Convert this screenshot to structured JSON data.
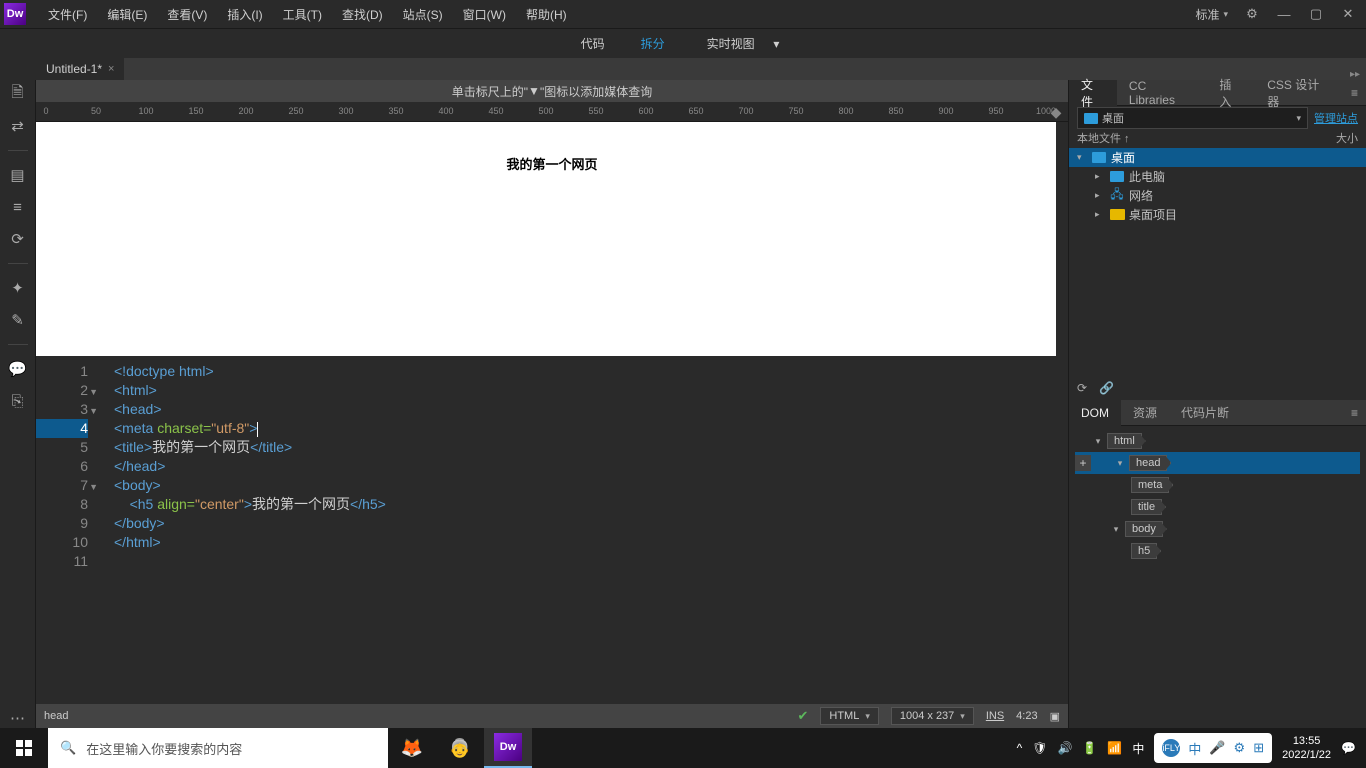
{
  "app": {
    "logo": "Dw"
  },
  "menu": [
    "文件(F)",
    "编辑(E)",
    "查看(V)",
    "插入(I)",
    "工具(T)",
    "查找(D)",
    "站点(S)",
    "窗口(W)",
    "帮助(H)"
  ],
  "workspace_label": "标准",
  "view_modes": {
    "code": "代码",
    "split": "拆分",
    "live": "实时视图"
  },
  "document_tab": "Untitled-1*",
  "live_hint_prefix": "单击标尺上的\"",
  "live_hint_suffix": "\"图标以添加媒体查询",
  "ruler_marks": [
    0,
    50,
    100,
    150,
    200,
    250,
    300,
    350,
    400,
    450,
    500,
    550,
    600,
    650,
    700,
    750,
    800,
    850,
    900,
    950,
    1000
  ],
  "preview_h5": "我的第一个网页",
  "code": {
    "l1": "<!doctype html>",
    "l2": "<html>",
    "l3": "<head>",
    "l4_tag": "<meta ",
    "l4_attr": "charset=",
    "l4_str": "\"utf-8\"",
    "l4_end": ">",
    "l5_open": "<title>",
    "l5_txt": "我的第一个网页",
    "l5_close": "</title>",
    "l6": "</head>",
    "l7": "<body>",
    "l8_open": "<h5 ",
    "l8_attr": "align=",
    "l8_str": "\"center\"",
    "l8_mid": ">",
    "l8_txt": "我的第一个网页",
    "l8_close": "</h5>",
    "l9": "</body>",
    "l10": "</html>"
  },
  "line_numbers": [
    "1",
    "2",
    "3",
    "4",
    "5",
    "6",
    "7",
    "8",
    "9",
    "10",
    "11"
  ],
  "status": {
    "crumb": "head",
    "lang": "HTML",
    "dims": "1004 x 237",
    "ins": "INS",
    "pos": "4:23"
  },
  "panels": {
    "files_tabs": [
      "文件",
      "CC Libraries",
      "插入",
      "CSS 设计器"
    ],
    "files_location": "桌面",
    "manage_sites": "管理站点",
    "col_local": "本地文件 ↑",
    "col_size": "大小",
    "tree": {
      "root": "桌面",
      "pc": "此电脑",
      "net": "网络",
      "proj": "桌面项目"
    },
    "dom_tabs": [
      "DOM",
      "资源",
      "代码片断"
    ],
    "dom_nodes": {
      "html": "html",
      "head": "head",
      "meta": "meta",
      "title": "title",
      "body": "body",
      "h5": "h5"
    }
  },
  "taskbar": {
    "search_placeholder": "在这里输入你要搜索的内容",
    "time": "13:55",
    "date": "2022/1/22",
    "ime": "中"
  }
}
